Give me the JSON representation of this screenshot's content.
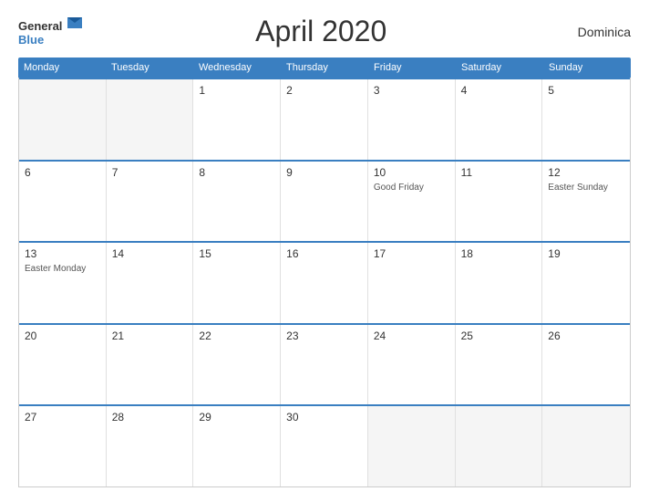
{
  "header": {
    "logo_general": "General",
    "logo_blue": "Blue",
    "title": "April 2020",
    "country": "Dominica"
  },
  "weekdays": [
    "Monday",
    "Tuesday",
    "Wednesday",
    "Thursday",
    "Friday",
    "Saturday",
    "Sunday"
  ],
  "weeks": [
    [
      {
        "day": "",
        "empty": true
      },
      {
        "day": "",
        "empty": true
      },
      {
        "day": "1",
        "empty": false
      },
      {
        "day": "2",
        "empty": false
      },
      {
        "day": "3",
        "empty": false
      },
      {
        "day": "4",
        "empty": false
      },
      {
        "day": "5",
        "empty": false
      }
    ],
    [
      {
        "day": "6",
        "empty": false
      },
      {
        "day": "7",
        "empty": false
      },
      {
        "day": "8",
        "empty": false
      },
      {
        "day": "9",
        "empty": false
      },
      {
        "day": "10",
        "empty": false,
        "event": "Good Friday"
      },
      {
        "day": "11",
        "empty": false
      },
      {
        "day": "12",
        "empty": false,
        "event": "Easter Sunday"
      }
    ],
    [
      {
        "day": "13",
        "empty": false,
        "event": "Easter Monday"
      },
      {
        "day": "14",
        "empty": false
      },
      {
        "day": "15",
        "empty": false
      },
      {
        "day": "16",
        "empty": false
      },
      {
        "day": "17",
        "empty": false
      },
      {
        "day": "18",
        "empty": false
      },
      {
        "day": "19",
        "empty": false
      }
    ],
    [
      {
        "day": "20",
        "empty": false
      },
      {
        "day": "21",
        "empty": false
      },
      {
        "day": "22",
        "empty": false
      },
      {
        "day": "23",
        "empty": false
      },
      {
        "day": "24",
        "empty": false
      },
      {
        "day": "25",
        "empty": false
      },
      {
        "day": "26",
        "empty": false
      }
    ],
    [
      {
        "day": "27",
        "empty": false
      },
      {
        "day": "28",
        "empty": false
      },
      {
        "day": "29",
        "empty": false
      },
      {
        "day": "30",
        "empty": false
      },
      {
        "day": "",
        "empty": true
      },
      {
        "day": "",
        "empty": true
      },
      {
        "day": "",
        "empty": true
      }
    ]
  ]
}
